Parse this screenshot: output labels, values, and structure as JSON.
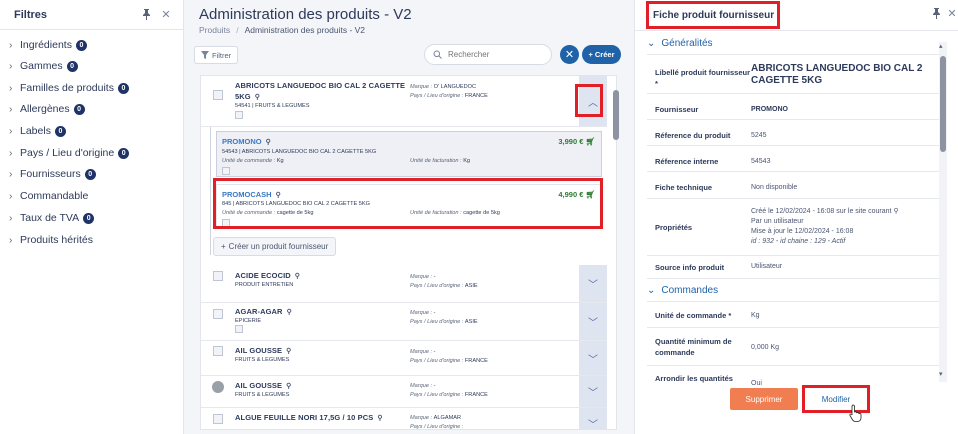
{
  "filters": {
    "title": "Filtres",
    "items": [
      {
        "label": "Ingrédients",
        "count": "0"
      },
      {
        "label": "Gammes",
        "count": "0"
      },
      {
        "label": "Familles de produits",
        "count": "0"
      },
      {
        "label": "Allergènes",
        "count": "0"
      },
      {
        "label": "Labels",
        "count": "0"
      },
      {
        "label": "Pays / Lieu d'origine",
        "count": "0"
      },
      {
        "label": "Fournisseurs",
        "count": "0"
      },
      {
        "label": "Commandable",
        "count": ""
      },
      {
        "label": "Taux de TVA",
        "count": "0"
      },
      {
        "label": "Produits hérités",
        "count": ""
      }
    ]
  },
  "center": {
    "title": "Administration des produits - V2",
    "breadcrumb": [
      "Produits",
      "Administration des produits - V2"
    ],
    "filter_btn": "Filtrer",
    "search_placeholder": "Rechercher",
    "create_btn": "Créer",
    "create_supplier": "Créer un produit fournisseur",
    "products": [
      {
        "name": "ABRICOTS LANGUEDOC BIO CAL 2 CAGETTE",
        "name2": "5KG",
        "code": "54541 | FRUITS & LEGUMES",
        "marque_lbl": "Marque :",
        "marque": "O' LANGUEDOC",
        "pays_lbl": "Pays / Lieu d'origine :",
        "pays": "FRANCE"
      },
      {
        "name": "ACIDE ECOCID",
        "code": "PRODUIT ENTRETIEN",
        "marque_lbl": "Marque :",
        "marque": "-",
        "pays_lbl": "Pays / Lieu d'origine :",
        "pays": "ASIE"
      },
      {
        "name": "AGAR-AGAR",
        "code": "EPICERIE",
        "marque_lbl": "Marque :",
        "marque": "-",
        "pays_lbl": "Pays / Lieu d'origine :",
        "pays": "ASIE"
      },
      {
        "name": "AIL GOUSSE",
        "code": "FRUITS & LEGUMES",
        "marque_lbl": "Marque :",
        "marque": "-",
        "pays_lbl": "Pays / Lieu d'origine :",
        "pays": "FRANCE"
      },
      {
        "name": "AIL GOUSSE",
        "code": "FRUITS & LEGUMES",
        "marque_lbl": "Marque :",
        "marque": "-",
        "pays_lbl": "Pays / Lieu d'origine :",
        "pays": "FRANCE"
      },
      {
        "name": "ALGUE FEUILLE NORI 17,5G / 10 PCS",
        "code": "",
        "marque_lbl": "Marque :",
        "marque": "ALGAMAR",
        "pays_lbl": "Pays / Lieu d'origine :",
        "pays": ""
      }
    ],
    "suppliers": [
      {
        "name": "PROMONO",
        "desc": "54543 | ABRICOTS LANGUEDOC BIO CAL 2 CAGETTE 5KG",
        "price": "3,990 €",
        "uc_lbl": "Unité de commande :",
        "uc": "Kg",
        "uf_lbl": "Unité de facturation :",
        "uf": "Kg"
      },
      {
        "name": "PROMOCASH",
        "desc": "845 | ABRICOTS LANGUEDOC BIO CAL 2 CAGETTE 5KG",
        "price": "4,990 €",
        "uc_lbl": "Unité de commande :",
        "uc": "cagette de 5kg",
        "uf_lbl": "Unité de facturation :",
        "uf": "cagette de 5kg"
      }
    ]
  },
  "detail": {
    "title": "Fiche produit fournisseur",
    "section1": "Généralités",
    "section2": "Commandes",
    "fields": {
      "libelle_lbl": "Libellé produit fournisseur *",
      "libelle": "ABRICOTS LANGUEDOC BIO CAL 2 CAGETTE 5KG",
      "fournisseur_lbl": "Fournisseur",
      "fournisseur": "PROMONO",
      "ref_lbl": "Réference du produit",
      "ref": "5245",
      "refint_lbl": "Réference interne",
      "refint": "54543",
      "fiche_lbl": "Fiche technique",
      "fiche": "Non disponible",
      "props_lbl": "Propriétés",
      "props1": "Créé le 12/02/2024 - 16:08 sur le site courant",
      "props2": "Par un utilisateur",
      "props3": "Mise à jour le 12/02/2024 - 16:08",
      "props4": "id : 932 - id chaine : 129 - Actif",
      "source_lbl": "Source info produit",
      "source": "Utilisateur",
      "uc_lbl": "Unité de commande *",
      "uc": "Kg",
      "qmin_lbl": "Quantité minimum de commande",
      "qmin": "0,000  Kg",
      "arr_lbl": "Arrondir les quantités",
      "arr": "Oui"
    },
    "btn_delete": "Supprimer",
    "btn_modify": "Modifier"
  },
  "colors": {
    "accent": "#1f62a8",
    "highlight": "#e01f26",
    "delete": "#f07e50",
    "price": "#2e7d32"
  }
}
